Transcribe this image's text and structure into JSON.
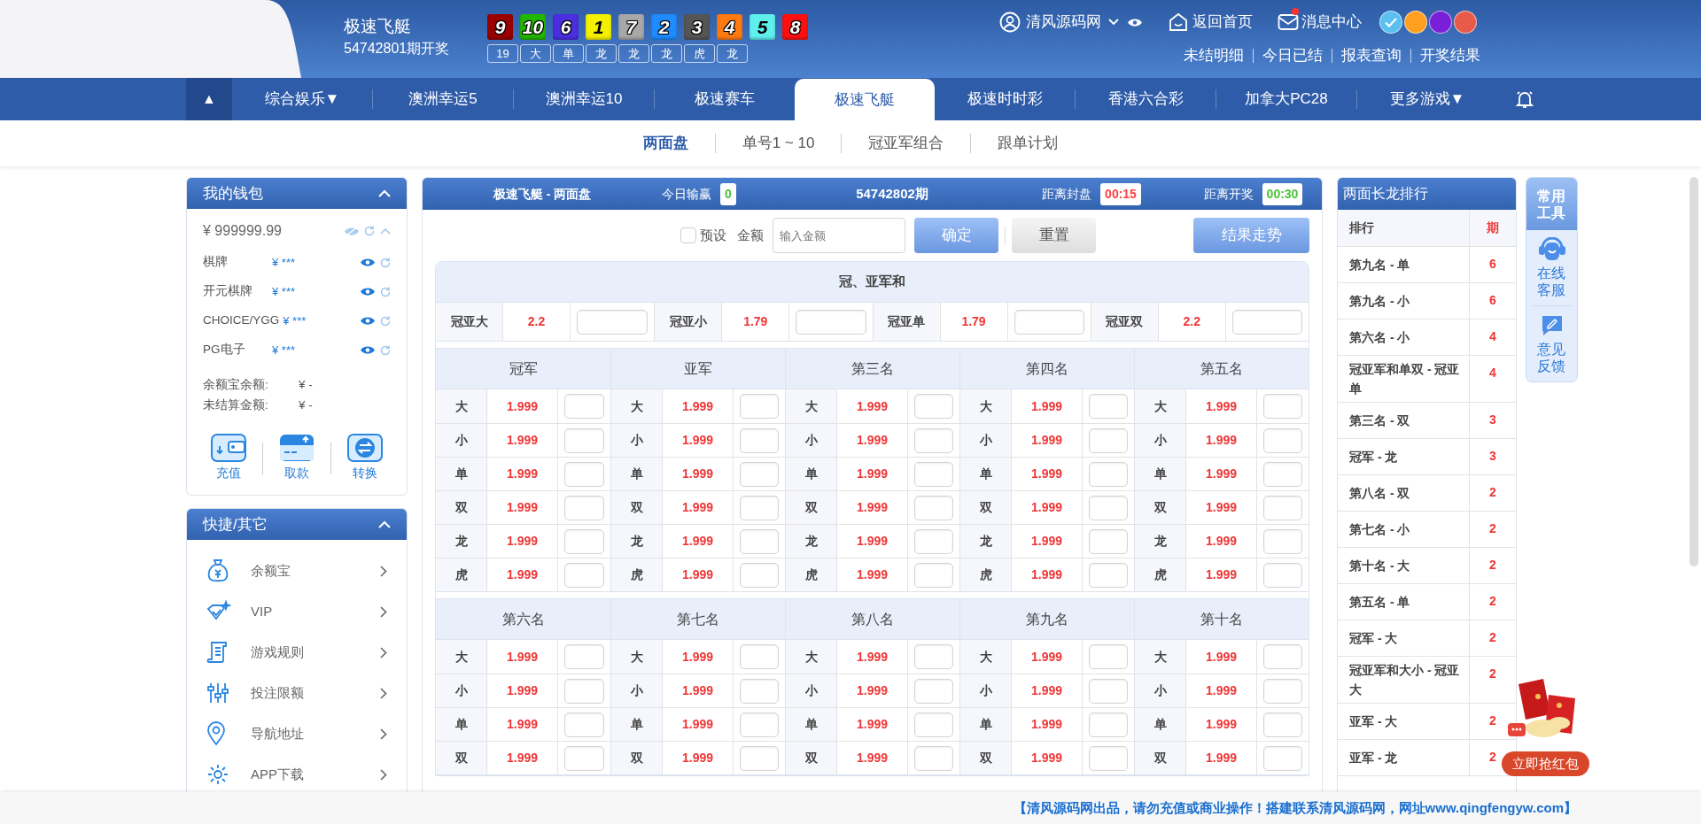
{
  "header": {
    "game_title": "极速飞艇",
    "draw_label": "54742801期开奖",
    "balls": [
      {
        "number": "9",
        "color": "#9a0000"
      },
      {
        "number": "10",
        "color": "#22b800"
      },
      {
        "number": "6",
        "color": "#4a2ee0"
      },
      {
        "number": "1",
        "color": "#f5f000"
      },
      {
        "number": "7",
        "color": "#a8a8a8"
      },
      {
        "number": "2",
        "color": "#1e8cff"
      },
      {
        "number": "3",
        "color": "#555555"
      },
      {
        "number": "4",
        "color": "#ff7a10"
      },
      {
        "number": "5",
        "color": "#5ff0ee"
      },
      {
        "number": "8",
        "color": "#ff1010"
      }
    ],
    "stats": [
      "19",
      "大",
      "单",
      "龙",
      "龙",
      "龙",
      "虎",
      "龙"
    ],
    "user": "清风源码网",
    "home_link": "返回首页",
    "messages": {
      "label": "消息中心",
      "unread": true
    },
    "themes": [
      {
        "color": "#5bc0f0",
        "selected": true
      },
      {
        "color": "#ffa020",
        "selected": false
      },
      {
        "color": "#7a1fd8",
        "selected": false
      },
      {
        "color": "#e85a4a",
        "selected": false
      }
    ],
    "sub_links": [
      "未结明细",
      "今日已结",
      "报表查询",
      "开奖结果"
    ]
  },
  "nav": {
    "collapse_symbol": "▲",
    "items": [
      {
        "label": "综合娱乐▼",
        "selected": false
      },
      {
        "label": "澳洲幸运5",
        "selected": false
      },
      {
        "label": "澳洲幸运10",
        "selected": false
      },
      {
        "label": "极速赛车",
        "selected": false
      },
      {
        "label": "极速飞艇",
        "selected": true
      },
      {
        "label": "极速时时彩",
        "selected": false
      },
      {
        "label": "香港六合彩",
        "selected": false
      },
      {
        "label": "加拿大PC28",
        "selected": false
      },
      {
        "label": "更多游戏▼",
        "selected": false
      }
    ]
  },
  "subnav": [
    {
      "label": "两面盘",
      "selected": true
    },
    {
      "label": "单号1 ~ 10",
      "selected": false
    },
    {
      "label": "冠亚军组合",
      "selected": false
    },
    {
      "label": "跟单计划",
      "selected": false
    }
  ],
  "wallet": {
    "title": "我的钱包",
    "balance": "¥ 999999.99",
    "accounts": [
      {
        "name": "棋牌",
        "amount": "¥ ***"
      },
      {
        "name": "开元棋牌",
        "amount": "¥ ***"
      },
      {
        "name": "CHOICE/YGG",
        "amount": "¥ ***"
      },
      {
        "name": "PG电子",
        "amount": "¥ ***"
      }
    ],
    "stats": [
      {
        "label": "余额宝余额:",
        "value": "¥ -"
      },
      {
        "label": "未结算金额:",
        "value": "¥ -"
      }
    ],
    "actions": [
      "充值",
      "取款",
      "转换"
    ]
  },
  "quick": {
    "title": "快捷/其它",
    "items": [
      "余额宝",
      "VIP",
      "游戏规则",
      "投注限额",
      "导航地址",
      "APP下载"
    ]
  },
  "bet_panel": {
    "title": "极速飞艇 - 两面盘",
    "today_label": "今日输赢",
    "today_value": "0",
    "period": "54742802期",
    "close_label": "距离封盘",
    "close_time": "00:15",
    "open_label": "距离开奖",
    "open_time": "00:30",
    "preset": {
      "label": "预设",
      "checked": false
    },
    "amount_label": "金额",
    "amount_placeholder": "输入金额",
    "confirm": "确定",
    "reset": "重置",
    "trend": "结果走势",
    "sum_section": {
      "title": "冠、亚军和",
      "cells": [
        {
          "label": "冠亚大",
          "odds": "2.2"
        },
        {
          "label": "冠亚小",
          "odds": "1.79"
        },
        {
          "label": "冠亚单",
          "odds": "1.79"
        },
        {
          "label": "冠亚双",
          "odds": "2.2"
        }
      ]
    },
    "groups": [
      {
        "columns": [
          {
            "title": "冠军",
            "rows": [
              {
                "label": "大",
                "odds": "1.999"
              },
              {
                "label": "小",
                "odds": "1.999"
              },
              {
                "label": "单",
                "odds": "1.999"
              },
              {
                "label": "双",
                "odds": "1.999"
              },
              {
                "label": "龙",
                "odds": "1.999"
              },
              {
                "label": "虎",
                "odds": "1.999"
              }
            ]
          },
          {
            "title": "亚军",
            "rows": [
              {
                "label": "大",
                "odds": "1.999"
              },
              {
                "label": "小",
                "odds": "1.999"
              },
              {
                "label": "单",
                "odds": "1.999"
              },
              {
                "label": "双",
                "odds": "1.999"
              },
              {
                "label": "龙",
                "odds": "1.999"
              },
              {
                "label": "虎",
                "odds": "1.999"
              }
            ]
          },
          {
            "title": "第三名",
            "rows": [
              {
                "label": "大",
                "odds": "1.999"
              },
              {
                "label": "小",
                "odds": "1.999"
              },
              {
                "label": "单",
                "odds": "1.999"
              },
              {
                "label": "双",
                "odds": "1.999"
              },
              {
                "label": "龙",
                "odds": "1.999"
              },
              {
                "label": "虎",
                "odds": "1.999"
              }
            ]
          },
          {
            "title": "第四名",
            "rows": [
              {
                "label": "大",
                "odds": "1.999"
              },
              {
                "label": "小",
                "odds": "1.999"
              },
              {
                "label": "单",
                "odds": "1.999"
              },
              {
                "label": "双",
                "odds": "1.999"
              },
              {
                "label": "龙",
                "odds": "1.999"
              },
              {
                "label": "虎",
                "odds": "1.999"
              }
            ]
          },
          {
            "title": "第五名",
            "rows": [
              {
                "label": "大",
                "odds": "1.999"
              },
              {
                "label": "小",
                "odds": "1.999"
              },
              {
                "label": "单",
                "odds": "1.999"
              },
              {
                "label": "双",
                "odds": "1.999"
              },
              {
                "label": "龙",
                "odds": "1.999"
              },
              {
                "label": "虎",
                "odds": "1.999"
              }
            ]
          }
        ]
      },
      {
        "columns": [
          {
            "title": "第六名",
            "rows": [
              {
                "label": "大",
                "odds": "1.999"
              },
              {
                "label": "小",
                "odds": "1.999"
              },
              {
                "label": "单",
                "odds": "1.999"
              },
              {
                "label": "双",
                "odds": "1.999"
              }
            ]
          },
          {
            "title": "第七名",
            "rows": [
              {
                "label": "大",
                "odds": "1.999"
              },
              {
                "label": "小",
                "odds": "1.999"
              },
              {
                "label": "单",
                "odds": "1.999"
              },
              {
                "label": "双",
                "odds": "1.999"
              }
            ]
          },
          {
            "title": "第八名",
            "rows": [
              {
                "label": "大",
                "odds": "1.999"
              },
              {
                "label": "小",
                "odds": "1.999"
              },
              {
                "label": "单",
                "odds": "1.999"
              },
              {
                "label": "双",
                "odds": "1.999"
              }
            ]
          },
          {
            "title": "第九名",
            "rows": [
              {
                "label": "大",
                "odds": "1.999"
              },
              {
                "label": "小",
                "odds": "1.999"
              },
              {
                "label": "单",
                "odds": "1.999"
              },
              {
                "label": "双",
                "odds": "1.999"
              }
            ]
          },
          {
            "title": "第十名",
            "rows": [
              {
                "label": "大",
                "odds": "1.999"
              },
              {
                "label": "小",
                "odds": "1.999"
              },
              {
                "label": "单",
                "odds": "1.999"
              },
              {
                "label": "双",
                "odds": "1.999"
              }
            ]
          }
        ]
      }
    ]
  },
  "dragon": {
    "title": "两面长龙排行",
    "rank_header": "排行",
    "period_header": "期",
    "rows": [
      {
        "name": "第九名 - 单",
        "count": "6"
      },
      {
        "name": "第九名 - 小",
        "count": "6"
      },
      {
        "name": "第六名 - 小",
        "count": "4"
      },
      {
        "name": "冠亚军和单双 - 冠亚单",
        "count": "4"
      },
      {
        "name": "第三名 - 双",
        "count": "3"
      },
      {
        "name": "冠军 - 龙",
        "count": "3"
      },
      {
        "name": "第八名 - 双",
        "count": "2"
      },
      {
        "name": "第七名 - 小",
        "count": "2"
      },
      {
        "name": "第十名 - 大",
        "count": "2"
      },
      {
        "name": "第五名 - 单",
        "count": "2"
      },
      {
        "name": "冠军 - 大",
        "count": "2"
      },
      {
        "name": "冠亚军和大小 - 冠亚大",
        "count": "2"
      },
      {
        "name": "亚军 - 大",
        "count": "2"
      },
      {
        "name": "亚军 - 龙",
        "count": "2"
      }
    ]
  },
  "tools": {
    "title": "常用工具",
    "items": [
      "在线客服",
      "意见反馈"
    ]
  },
  "red_packet": {
    "label": "立即抢红包"
  },
  "footer": {
    "notice": "【清风源码网出品，请勿充值或商业操作！搭建联系清风源码网，网址www.qingfengyw.com】"
  }
}
